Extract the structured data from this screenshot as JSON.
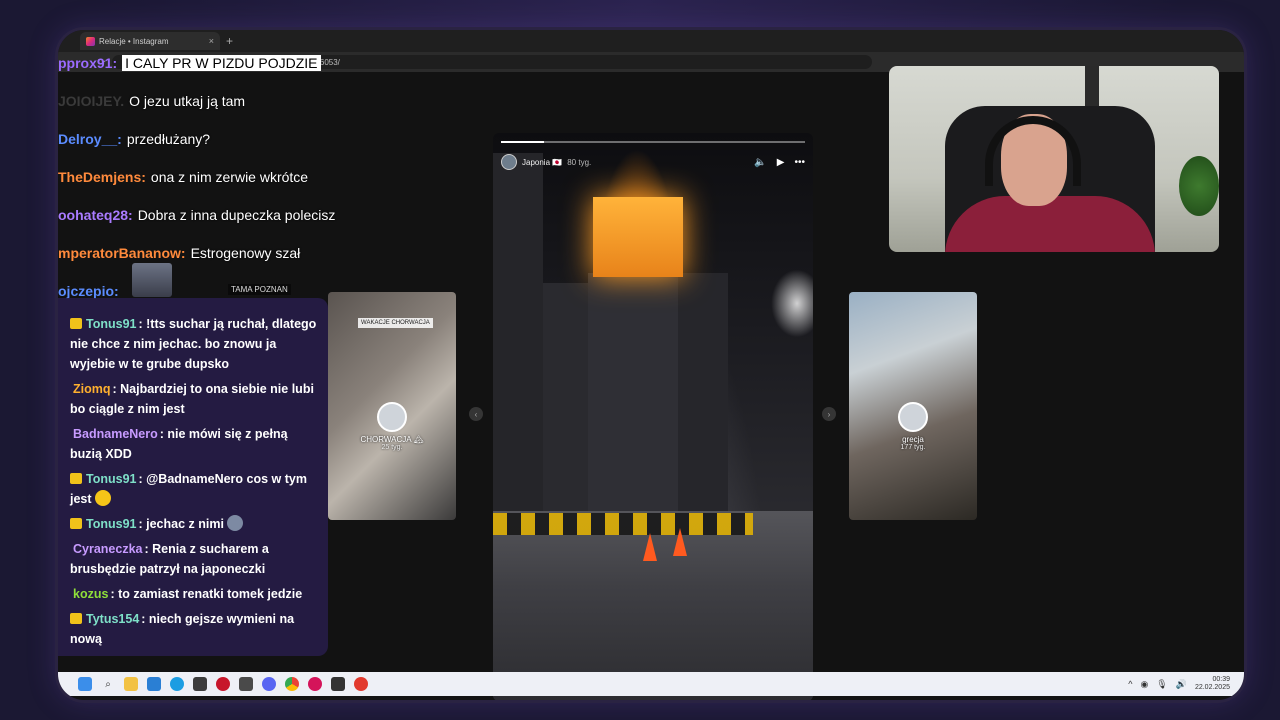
{
  "browser": {
    "tab_title": "Relacje • Instagram",
    "tab_close": "×",
    "new_tab": "+",
    "url": "instagram.com/stories/highlights/18000458224476053/"
  },
  "chat_overlay": [
    {
      "user": "pprox91:",
      "message": "I CALY PR W PIZDU POJDZIE",
      "color": "#9b6bff"
    },
    {
      "user": "JOIOIJEY.",
      "message": "O jezu utkaj ją tam",
      "color": "#3a3a3a"
    },
    {
      "user": "Delroy__:",
      "message": "przedłużany?",
      "color": "#5b8cff"
    },
    {
      "user": "TheDemjens:",
      "message": "ona z nim zerwie wkrótce",
      "color": "#ff8a3c"
    },
    {
      "user": "oohateq28:",
      "message": "Dobra z inna dupeczka polecisz",
      "color": "#a97bff"
    },
    {
      "user": "mperatorBananow:",
      "message": "Estrogenowy szał",
      "color": "#ff8a3c"
    },
    {
      "user": "ojczepio:",
      "message": "",
      "color": "#5b8cff"
    }
  ],
  "chat_panel": [
    {
      "user": "Tonus91",
      "message": ": !tts suchar ją ruchał, dlatego nie chce z nim jechac. bo znowu ja wyjebie w te grube dupsko",
      "color": "#7ee0c8",
      "badge": true
    },
    {
      "user": "Ziomq",
      "message": ": Najbardziej to ona siebie nie lubi bo ciągle z nim jest",
      "color": "#ffb02e",
      "badge": false
    },
    {
      "user": "BadnameNero",
      "message": ": nie mówi się z pełną buzią XDD",
      "color": "#c79bff",
      "badge": false
    },
    {
      "user": "Tonus91",
      "message": ": @BadnameNero cos w tym jest",
      "color": "#7ee0c8",
      "badge": true,
      "emote": "laugh-emote"
    },
    {
      "user": "Tonus91",
      "message": ": jechac z nimi",
      "color": "#7ee0c8",
      "badge": true,
      "emote": "face-emote"
    },
    {
      "user": "Cyraneczka",
      "message": ": Renia z sucharem a brusbędzie patrzył na japoneczki",
      "color": "#c79bff",
      "badge": false
    },
    {
      "user": "kozus",
      "message": ": to zamiast renatki tomek jedzie",
      "color": "#8fdf3a",
      "badge": false
    },
    {
      "user": "Tytus154",
      "message": ": niech gejsze wymieni na nową",
      "color": "#7ee0c8",
      "badge": true
    }
  ],
  "cam_label": "TAMA POZNAN",
  "stories": {
    "main": {
      "user": "Japonia 🇯🇵",
      "age": "80 tyg.",
      "progress": 0.14
    },
    "left": {
      "tag": "WAKACJE CHORWACJA",
      "name": "CHORWACJA 🏔",
      "age": "25 tyg."
    },
    "right": {
      "name": "grecja",
      "age": "177 tyg."
    },
    "nav_prev": "‹",
    "nav_next": "›"
  },
  "story_controls": {
    "mute": "🔈",
    "play": "▶",
    "more": "•••"
  },
  "taskbar": {
    "icons": [
      "windows-icon",
      "search-icon",
      "file-explorer-icon",
      "store-icon",
      "edge-icon",
      "app-icon",
      "record-icon",
      "app2-icon",
      "discord-icon",
      "chrome-icon",
      "app3-icon",
      "app4-icon",
      "app5-icon"
    ],
    "tray_up": "^",
    "time": "00:39",
    "date": "22.02.2025"
  }
}
